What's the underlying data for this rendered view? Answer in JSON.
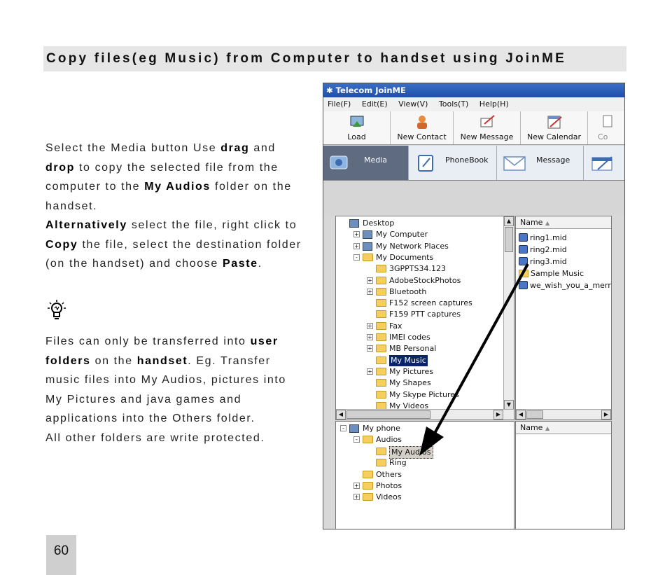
{
  "header": {
    "title": "Copy files(eg Music) from Computer to handset using JoinME"
  },
  "paragraph1": {
    "t1": "Select the Media button Use ",
    "b1": "drag",
    "t2": " and ",
    "b2": "drop",
    "t3": " to copy the selected file from the computer to the ",
    "b3": "My Audios",
    "t4": " folder on the handset."
  },
  "paragraph2": {
    "b1": "Alternatively",
    "t1": " select the file, right click to ",
    "b2": "Copy",
    "t2": " the file, select the destination folder (on the handset) and choose ",
    "b3": "Paste",
    "t3": "."
  },
  "tip": {
    "icon": "lightbulb-icon",
    "t1": "Files can only be transferred into ",
    "b1": "user folders",
    "t2": " on the ",
    "b2": "handset",
    "t3": ". Eg. Transfer music files into My Audios, pictures into My Pictures and java games and applications into the Others folder.",
    "line2": "All other folders are write protected."
  },
  "page_number": "60",
  "app": {
    "title": "Telecom JoinME",
    "menu": [
      "File(F)",
      "Edit(E)",
      "View(V)",
      "Tools(T)",
      "Help(H)"
    ],
    "toolbar": [
      "Load",
      "New Contact",
      "New Message",
      "New Calendar",
      "Co"
    ],
    "tabs": [
      "Media",
      "PhoneBook",
      "Message"
    ],
    "active_tab": "Media",
    "computer_tree": [
      {
        "label": "Desktop",
        "level": 0,
        "expander": ""
      },
      {
        "label": "My Computer",
        "level": 1,
        "expander": "+"
      },
      {
        "label": "My Network Places",
        "level": 1,
        "expander": "+"
      },
      {
        "label": "My Documents",
        "level": 1,
        "expander": "-"
      },
      {
        "label": "3GPPTS34.123",
        "level": 2,
        "expander": ""
      },
      {
        "label": "AdobeStockPhotos",
        "level": 2,
        "expander": "+"
      },
      {
        "label": "Bluetooth",
        "level": 2,
        "expander": "+"
      },
      {
        "label": "F152 screen captures",
        "level": 2,
        "expander": ""
      },
      {
        "label": "F159 PTT captures",
        "level": 2,
        "expander": ""
      },
      {
        "label": "Fax",
        "level": 2,
        "expander": "+"
      },
      {
        "label": "IMEI codes",
        "level": 2,
        "expander": "+"
      },
      {
        "label": "MB Personal",
        "level": 2,
        "expander": "+"
      },
      {
        "label": "My Music",
        "level": 2,
        "expander": "",
        "selected": true
      },
      {
        "label": "My Pictures",
        "level": 2,
        "expander": "+"
      },
      {
        "label": "My Shapes",
        "level": 2,
        "expander": ""
      },
      {
        "label": "My Skype Pictures",
        "level": 2,
        "expander": ""
      },
      {
        "label": "My Videos",
        "level": 2,
        "expander": ""
      }
    ],
    "file_list_header": "Name",
    "files": [
      {
        "label": "ring1.mid",
        "type": "file"
      },
      {
        "label": "ring2.mid",
        "type": "file"
      },
      {
        "label": "ring3.mid",
        "type": "file"
      },
      {
        "label": "Sample Music",
        "type": "folder"
      },
      {
        "label": "we_wish_you_a_merry_",
        "type": "file"
      }
    ],
    "phone_tree": [
      {
        "label": "My phone",
        "level": 0,
        "expander": "-"
      },
      {
        "label": "Audios",
        "level": 1,
        "expander": "-"
      },
      {
        "label": "My Audios",
        "level": 2,
        "expander": "",
        "selected": true
      },
      {
        "label": "Ring",
        "level": 2,
        "expander": ""
      },
      {
        "label": "Others",
        "level": 1,
        "expander": ""
      },
      {
        "label": "Photos",
        "level": 1,
        "expander": "+"
      },
      {
        "label": "Videos",
        "level": 1,
        "expander": "+"
      }
    ],
    "phone_list_header": "Name",
    "arrow_color": "#000000",
    "accent_color": "#0a246a"
  }
}
